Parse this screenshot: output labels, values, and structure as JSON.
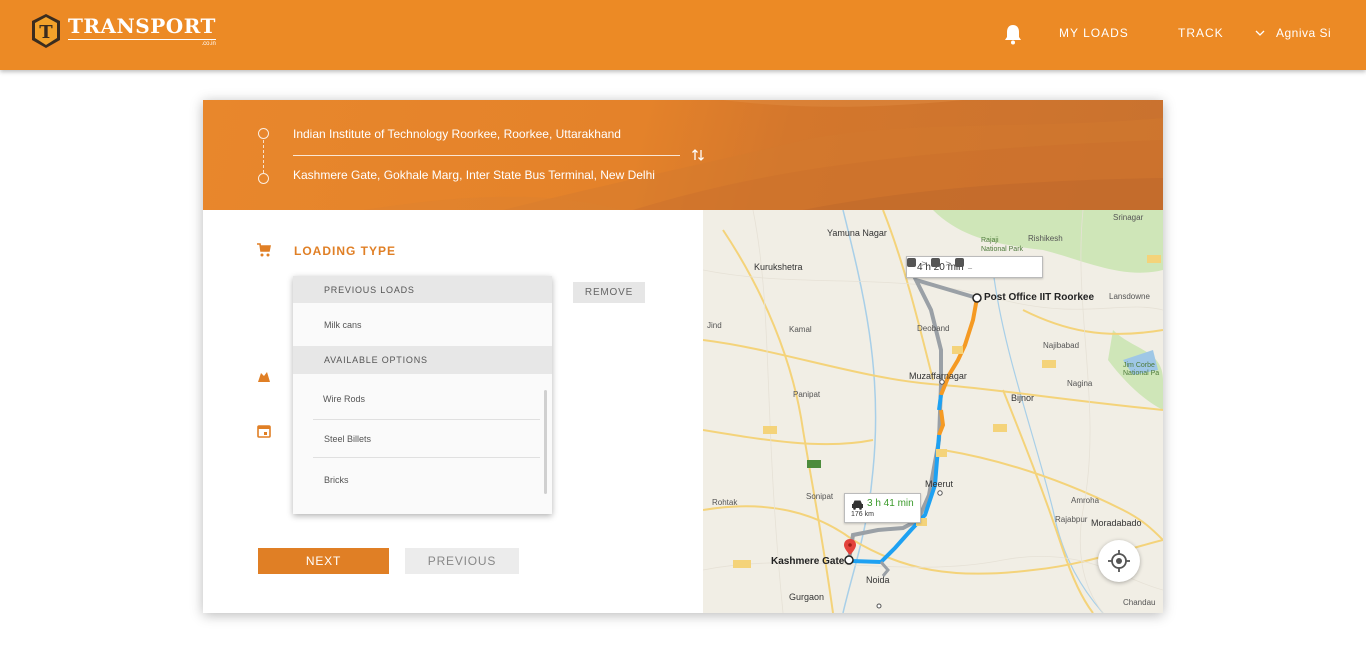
{
  "header": {
    "brand": "TRANSPORT",
    "brand_suffix": ".co.in",
    "logo_letter": "T",
    "nav": {
      "my_loads": "MY LOADS",
      "track": "TRACK"
    },
    "user_name": "Agniva Si",
    "accent_color": "#ec8a25"
  },
  "route": {
    "origin": "Indian Institute of Technology Roorkee, Roorkee, Uttarakhand",
    "destination": "Kashmere Gate, Gokhale Marg, Inter State Bus Terminal, New Delhi"
  },
  "form": {
    "loading_type_label": "LOADING TYPE",
    "remove_label": "REMOVE",
    "dropdown": {
      "previous_header": "PREVIOUS LOADS",
      "previous_items": [
        "Milk cans"
      ],
      "available_header": "AVAILABLE OPTIONS",
      "available_items": [
        "Wire Rods",
        "Steel Billets",
        "Bricks"
      ]
    },
    "next_label": "NEXT",
    "previous_label": "PREVIOUS"
  },
  "map": {
    "transit_time": "4 h 20 min",
    "drive_time": "3 h 41 min",
    "drive_distance": "176 km",
    "labels": {
      "origin": "Post Office IIT Roorkee",
      "destination": "Kashmere Gate",
      "yamuna_nagar": "Yamuna Nagar",
      "kurukshetra": "Kurukshetra",
      "deoband": "Deoband",
      "muzaffarnagar": "Muzaffarnagar",
      "kamal": "Kamal",
      "panipat": "Panipat",
      "meerut": "Meerut",
      "sonipat": "Sonipat",
      "rohtak": "Rohtak",
      "noida": "Noida",
      "gurgaon": "Gurgaon",
      "bijnor": "Bijnor",
      "najibabad": "Najibabad",
      "nagina": "Nagina",
      "amroha": "Amroha",
      "moradabad": "Moradabado",
      "rishikesh": "Rishikesh",
      "srinagar": "Srinagar",
      "lansdowne": "Lansdowne",
      "rajaji": "Rajaji National Park",
      "jim_corbett": "Jim Corbe National Pa",
      "jind": "Jind",
      "rajabpur": "Rajabpur",
      "chandau": "Chandau"
    }
  }
}
